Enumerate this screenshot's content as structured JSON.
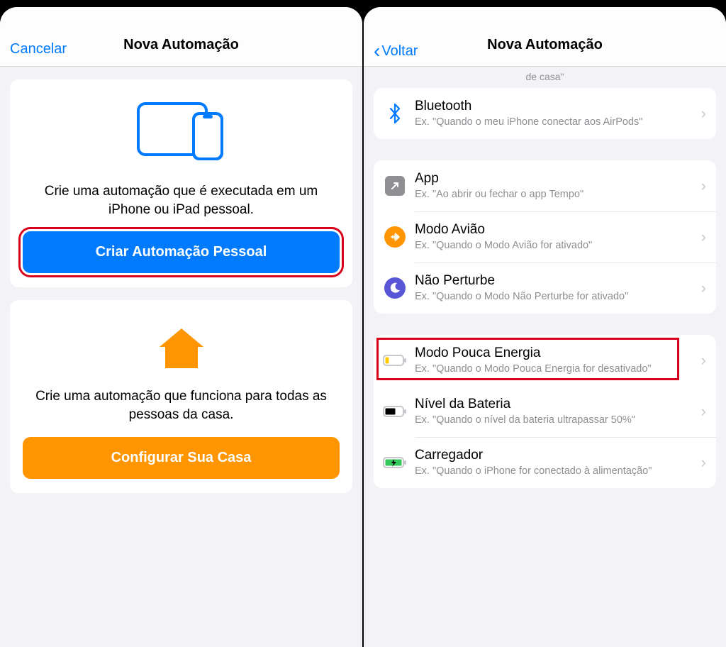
{
  "left": {
    "cancel": "Cancelar",
    "title": "Nova Automação",
    "personal": {
      "desc": "Crie uma automação que é executada em um iPhone ou iPad pessoal.",
      "button": "Criar Automação Pessoal"
    },
    "home": {
      "desc": "Crie uma automação que funciona para todas as pessoas da casa.",
      "button": "Configurar Sua Casa"
    }
  },
  "right": {
    "back": "Voltar",
    "title": "Nova Automação",
    "truncated": "de casa\"",
    "bluetooth": {
      "title": "Bluetooth",
      "sub": "Ex. \"Quando o meu iPhone conectar aos AirPods\""
    },
    "app": {
      "title": "App",
      "sub": "Ex. \"Ao abrir ou fechar o app Tempo\""
    },
    "airplane": {
      "title": "Modo Avião",
      "sub": "Ex. \"Quando o Modo Avião for ativado\""
    },
    "dnd": {
      "title": "Não Perturbe",
      "sub": "Ex. \"Quando o Modo Não Perturbe for ativado\""
    },
    "lowpower": {
      "title": "Modo Pouca Energia",
      "sub": "Ex. \"Quando o Modo Pouca Energia for desativado\""
    },
    "battery": {
      "title": "Nível da Bateria",
      "sub": "Ex. \"Quando o nível da bateria ultrapassar 50%\""
    },
    "charger": {
      "title": "Carregador",
      "sub": "Ex. \"Quando o iPhone for conectado à alimentação\""
    }
  }
}
